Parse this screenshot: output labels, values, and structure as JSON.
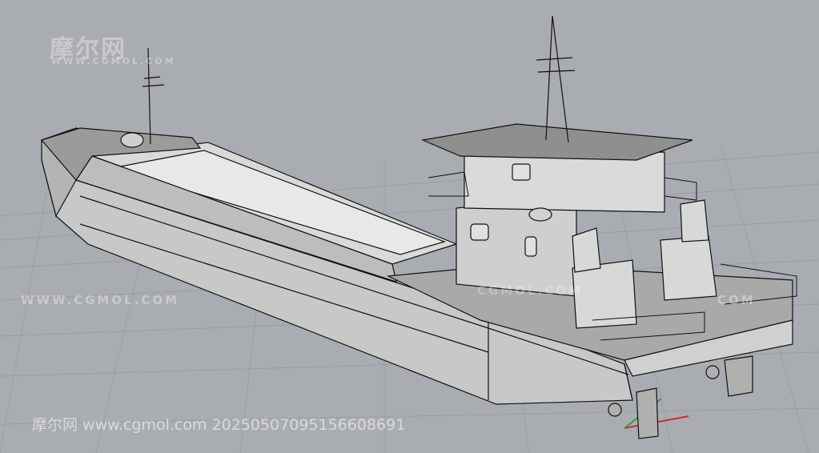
{
  "watermarks": {
    "logo_cn": "摩尔网",
    "logo_url": "WWW.CGMOL.COM",
    "url_left": "WWW.CGMOL.COM",
    "url_mid": "CGMOL.COM",
    "url_right": "COM",
    "footer": "摩尔网 www.cgmol.com 20250507095156608691"
  },
  "colors": {
    "background": "#a9adb2",
    "grid": "#9a9ea3",
    "hull": "#c9c9c9",
    "deck": "#b8b8b8",
    "outline": "#111111",
    "axis_x": "#c8302c",
    "axis_y": "#3a9a3a"
  }
}
